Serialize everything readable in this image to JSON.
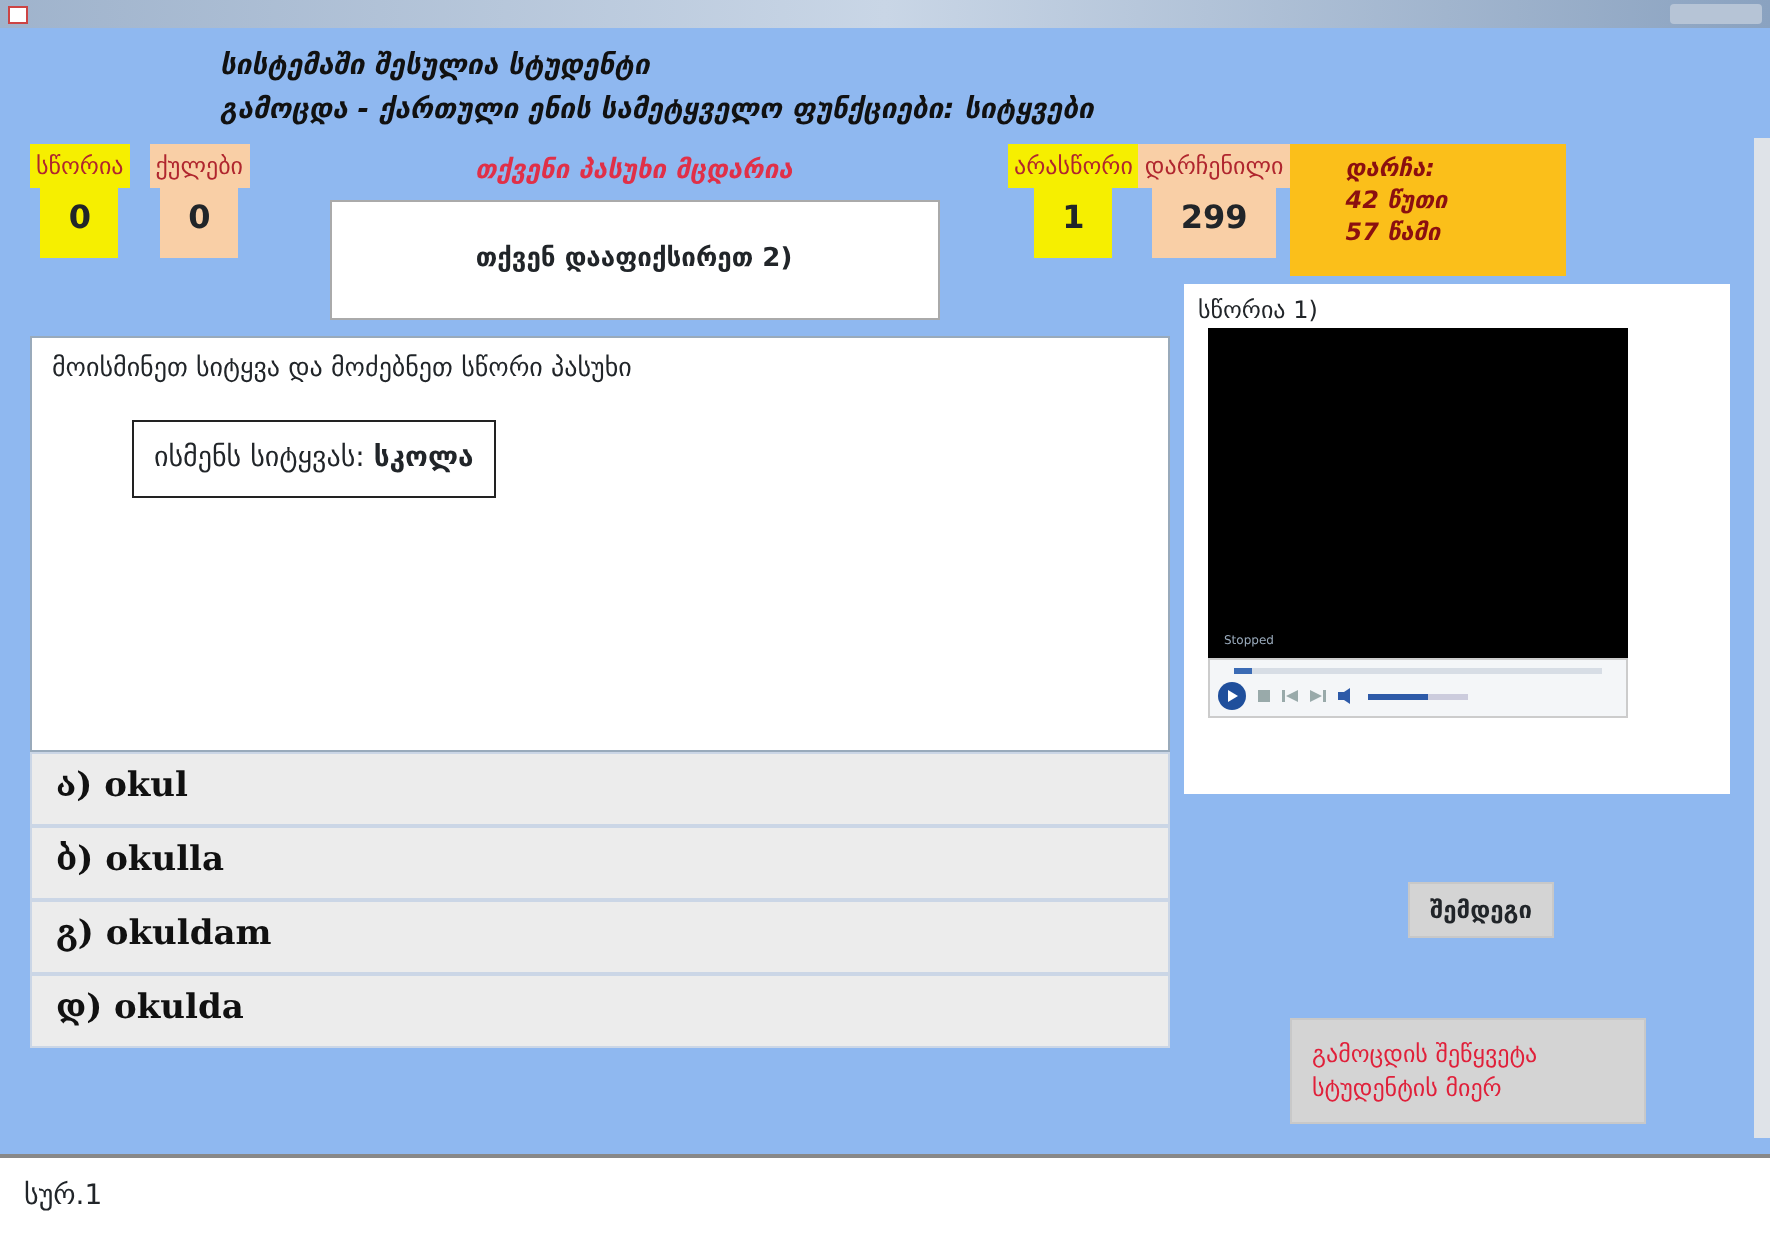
{
  "header": {
    "line_1": "სისტემაში შესულია სტუდენტი",
    "line_2": "გამოცდა - ქართული ენის სამეტყველო ფუნქციები: სიტყვები"
  },
  "stats_left": [
    {
      "label": "სწორია",
      "value": "0",
      "color": "#f6ef00"
    },
    {
      "label": "ქულები",
      "value": "0",
      "color": "#f9cfa6"
    }
  ],
  "feedback": {
    "message": "თქვენი პასუხი მცდარია",
    "answer": "თქვენ დააფიქსირეთ 2)"
  },
  "stats_right": [
    {
      "label": "არასწორი",
      "value": "1",
      "color": "#f6ef00"
    },
    {
      "label": "დარჩენილი",
      "value": "299",
      "color": "#f9cfa6"
    }
  ],
  "timer": {
    "label": "დარჩა:",
    "minutes": "42 წუთი",
    "seconds": "57 წამი"
  },
  "question": {
    "instruction": "მოისმინეთ სიტყვა და მოძებნეთ სწორი პასუხი",
    "prompt": "ისმენს სიტყვას: **სკოლა**"
  },
  "options": [
    {
      "label": "ა) okul",
      "selected": false
    },
    {
      "label": "ბ) okulla",
      "selected": false
    },
    {
      "label": "გ) okuldam",
      "selected": false
    },
    {
      "label": "დ) okulda",
      "selected": false
    }
  ],
  "media": {
    "caption": "სწორია 1)",
    "status": "Stopped",
    "seek": {
      "level": 0.05
    },
    "volume": {
      "level": 0.6
    }
  },
  "buttons": {
    "next": "შემდეგი",
    "abort": "გამოცდის შეწყვეტა სტუდენტის მიერ"
  },
  "status_bar": "სურ.1"
}
